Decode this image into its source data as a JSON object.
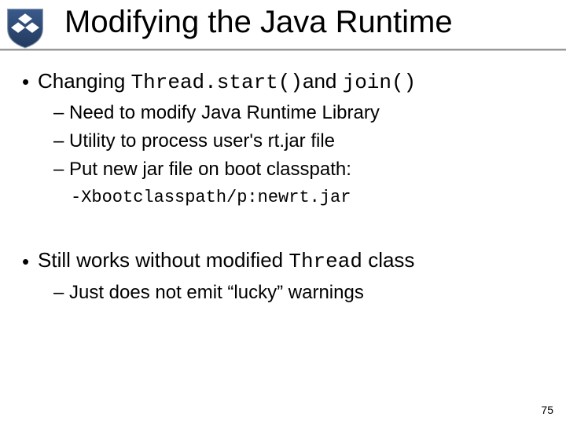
{
  "title": "Modifying the Java Runtime",
  "b1": {
    "pre": "Changing ",
    "code1": "Thread.start()",
    "mid": "and ",
    "code2": "join()",
    "sub": {
      "s1": "Need to modify Java Runtime Library",
      "s2": "Utility to process user's rt.jar file",
      "s3": "Put new jar file on boot classpath:",
      "cmd": "-Xbootclasspath/p:newrt.jar"
    }
  },
  "b2": {
    "pre": "Still works without modified ",
    "code": "Thread",
    "post": " class",
    "sub": {
      "s1": "Just does not emit “lucky” warnings"
    }
  },
  "page": "75"
}
